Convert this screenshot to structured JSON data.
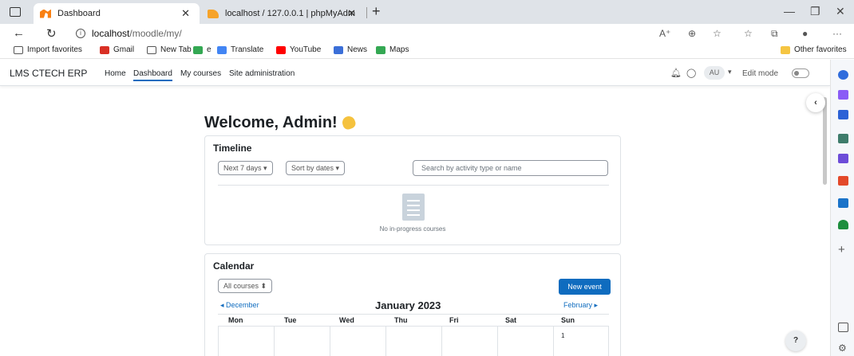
{
  "browser": {
    "tabs": [
      {
        "title": "Dashboard",
        "active": true
      },
      {
        "title": "localhost / 127.0.0.1 | phpMyAdm",
        "active": false
      }
    ],
    "url_host": "localhost",
    "url_path": "/moodle/my/",
    "reader_mode_label": "A⁺",
    "bookmarks": [
      "Import favorites",
      "Gmail",
      "New Tab",
      "e",
      "Translate",
      "YouTube",
      "News",
      "Maps"
    ],
    "other_favorites": "Other favorites"
  },
  "moodle_nav": {
    "brand": "LMS CTECH ERP",
    "links": [
      "Home",
      "Dashboard",
      "My courses",
      "Site administration"
    ],
    "avatar_initials": "AU",
    "edit_mode_label": "Edit mode",
    "edit_mode_on": false
  },
  "page": {
    "welcome": "Welcome, Admin!"
  },
  "timeline": {
    "title": "Timeline",
    "filter_days": "Next 7 days",
    "sort": "Sort by dates",
    "search_placeholder": "Search by activity type or name",
    "empty_message": "No in-progress courses"
  },
  "calendar": {
    "title": "Calendar",
    "course_filter": "All courses",
    "new_event": "New event",
    "prev_month": "December",
    "next_month": "February",
    "month_title": "January 2023",
    "weekdays": [
      "Mon",
      "Tue",
      "Wed",
      "Thu",
      "Fri",
      "Sat",
      "Sun"
    ],
    "first_day": "1"
  },
  "help_label": "?",
  "colors": {
    "primary": "#0f6cbf",
    "brand_orange": "#f98012"
  }
}
